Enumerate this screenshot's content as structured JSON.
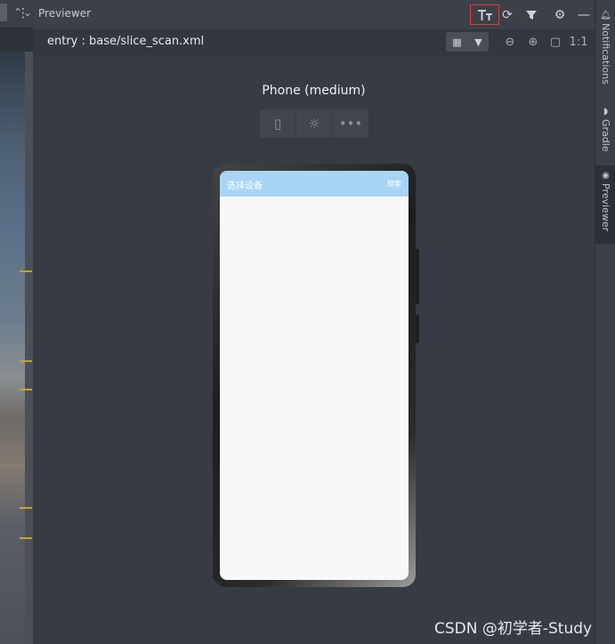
{
  "header": {
    "title": "Previewer",
    "more_icon": "more-vertical-icon",
    "buttons": [
      "font-scale-icon",
      "refresh-icon",
      "component-tree-icon",
      "gear-icon",
      "minimize-icon"
    ]
  },
  "left_panel": {
    "buttons": [
      "chevron-up-icon",
      "chevron-down-icon"
    ]
  },
  "toolbar": {
    "path": "entry : base/slice_scan.xml",
    "zoom_out": "zoom-out-icon",
    "zoom_in": "zoom-in-icon",
    "fit": "fit-screen-icon",
    "actual_size": "1:1"
  },
  "device": {
    "name": "Phone (medium)"
  },
  "app": {
    "title": "选择设备",
    "action": "搜索"
  },
  "sidebar": {
    "items": [
      {
        "label": "Notifications",
        "icon": "bell-icon"
      },
      {
        "label": "Gradle",
        "icon": "gradle-icon"
      },
      {
        "label": "Previewer",
        "icon": "eye-icon"
      }
    ]
  },
  "watermark": "CSDN @初学者-Study",
  "colors": {
    "highlight": "#e0403a",
    "appbar": "#a8d4f6"
  }
}
